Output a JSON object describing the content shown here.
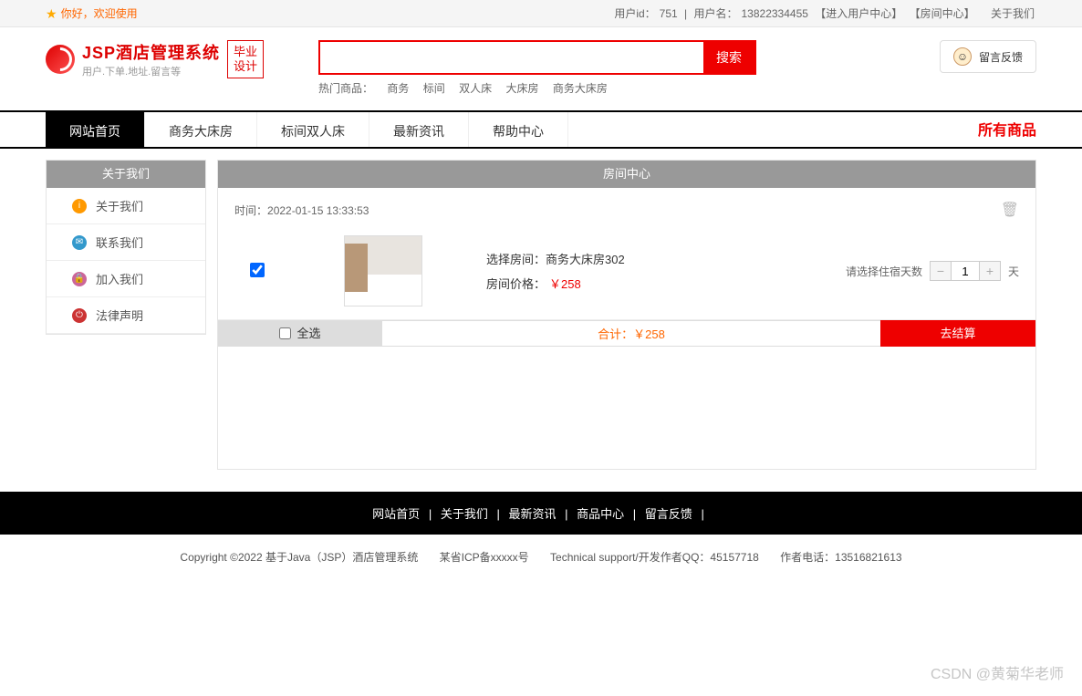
{
  "topbar": {
    "greet": "你好，欢迎使用",
    "user_id_label": "用户id：",
    "user_id": "751",
    "sep": " | ",
    "username_label": "用户名：",
    "username": "13822334455",
    "user_center": "【进入用户中心】",
    "room_center": "【房间中心】",
    "about": "关于我们"
  },
  "logo": {
    "title": "JSP酒店管理系统",
    "sub": "用户.下单.地址.留言等",
    "badge1": "毕业",
    "badge2": "设计"
  },
  "search": {
    "button": "搜索",
    "hot_label": "热门商品：",
    "hot_items": [
      "商务",
      "标间",
      "双人床",
      "大床房",
      "商务大床房"
    ]
  },
  "feedback": {
    "label": "留言反馈"
  },
  "nav": {
    "items": [
      "网站首页",
      "商务大床房",
      "标间双人床",
      "最新资讯",
      "帮助中心"
    ],
    "right": "所有商品"
  },
  "sidebar": {
    "title": "关于我们",
    "items": [
      {
        "label": "关于我们"
      },
      {
        "label": "联系我们"
      },
      {
        "label": "加入我们"
      },
      {
        "label": "法律声明"
      }
    ]
  },
  "content": {
    "title": "房间中心",
    "time_label": "时间：",
    "time_value": "2022-01-15 13:33:53",
    "room": {
      "name_label": "选择房间：",
      "name": "商务大床房302",
      "price_label": "房间价格：",
      "price": "￥258",
      "days_label": "请选择住宿天数",
      "days": "1",
      "unit": "天"
    },
    "total": {
      "all": "全选",
      "sum_label": "合计：",
      "sum": "￥258",
      "checkout": "去结算"
    }
  },
  "footer": {
    "links": [
      "网站首页",
      "关于我们",
      "最新资讯",
      "商品中心",
      "留言反馈"
    ],
    "sep": "|",
    "copy": "Copyright ©2022 基于Java（JSP）酒店管理系统",
    "icp": "某省ICP备xxxxx号",
    "support": "Technical support/开发作者QQ：45157718",
    "phone": "作者电话：13516821613"
  },
  "watermark": "CSDN @黄菊华老师"
}
